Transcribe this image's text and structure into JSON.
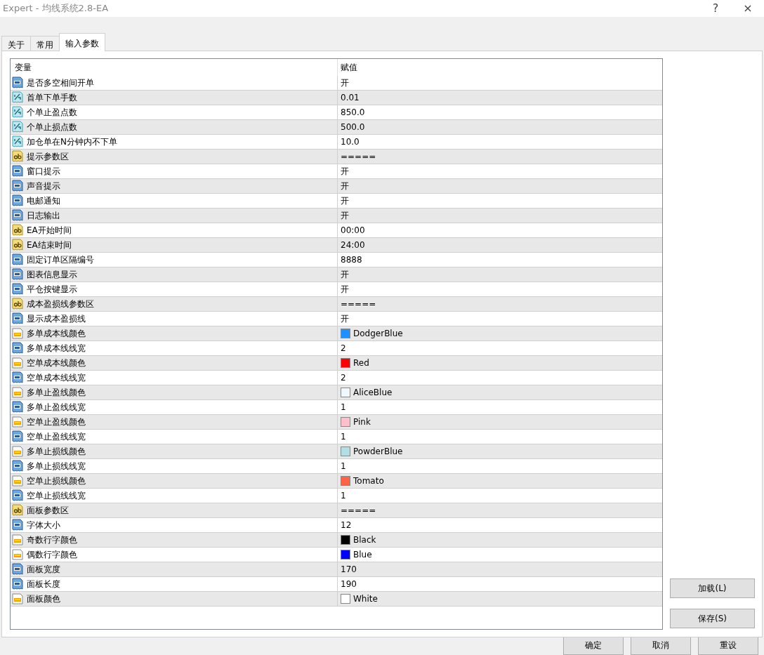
{
  "window": {
    "title": "Expert - 均线系统2.8-EA",
    "help": "?",
    "close": "×"
  },
  "tabs": [
    {
      "label": "关于",
      "selected": false
    },
    {
      "label": "常用",
      "selected": false
    },
    {
      "label": "输入参数",
      "selected": true
    }
  ],
  "table": {
    "columns": [
      "变量",
      "赋值"
    ],
    "rows": [
      {
        "kind": "int",
        "name": "是否多空相间开单",
        "value": "开"
      },
      {
        "kind": "double",
        "name": "首单下单手数",
        "value": "0.01"
      },
      {
        "kind": "double",
        "name": "个单止盈点数",
        "value": "850.0"
      },
      {
        "kind": "double",
        "name": "个单止损点数",
        "value": "500.0"
      },
      {
        "kind": "double",
        "name": "加仓单在N分钟内不下单",
        "value": "10.0"
      },
      {
        "kind": "string",
        "name": "提示参数区",
        "value": "====="
      },
      {
        "kind": "int",
        "name": "窗口提示",
        "value": "开"
      },
      {
        "kind": "int",
        "name": "声音提示",
        "value": "开"
      },
      {
        "kind": "int",
        "name": "电邮通知",
        "value": "开"
      },
      {
        "kind": "int",
        "name": "日志输出",
        "value": "开"
      },
      {
        "kind": "string",
        "name": "EA开始时间",
        "value": "00:00"
      },
      {
        "kind": "string",
        "name": "EA结束时间",
        "value": "24:00"
      },
      {
        "kind": "int",
        "name": "固定订单区隔编号",
        "value": "8888"
      },
      {
        "kind": "int",
        "name": "图表信息显示",
        "value": "开"
      },
      {
        "kind": "int",
        "name": "平仓按键显示",
        "value": "开"
      },
      {
        "kind": "string",
        "name": "成本盈损线参数区",
        "value": "====="
      },
      {
        "kind": "int",
        "name": "显示成本盈损线",
        "value": "开"
      },
      {
        "kind": "color",
        "name": "多单成本线颜色",
        "value": "DodgerBlue",
        "color": "#1e90ff"
      },
      {
        "kind": "int",
        "name": "多单成本线线宽",
        "value": "2"
      },
      {
        "kind": "color",
        "name": "空单成本线颜色",
        "value": "Red",
        "color": "#ff0000"
      },
      {
        "kind": "int",
        "name": "空单成本线线宽",
        "value": "2"
      },
      {
        "kind": "color",
        "name": "多单止盈线颜色",
        "value": "AliceBlue",
        "color": "#f0f8ff"
      },
      {
        "kind": "int",
        "name": "多单止盈线线宽",
        "value": "1"
      },
      {
        "kind": "color",
        "name": "空单止盈线颜色",
        "value": "Pink",
        "color": "#ffc0cb"
      },
      {
        "kind": "int",
        "name": "空单止盈线线宽",
        "value": "1"
      },
      {
        "kind": "color",
        "name": "多单止损线颜色",
        "value": "PowderBlue",
        "color": "#b0e0e6"
      },
      {
        "kind": "int",
        "name": "多单止损线线宽",
        "value": "1"
      },
      {
        "kind": "color",
        "name": "空单止损线颜色",
        "value": "Tomato",
        "color": "#ff6347"
      },
      {
        "kind": "int",
        "name": "空单止损线线宽",
        "value": "1"
      },
      {
        "kind": "string",
        "name": "面板参数区",
        "value": "====="
      },
      {
        "kind": "int",
        "name": "字体大小",
        "value": "12"
      },
      {
        "kind": "color",
        "name": "奇数行字颜色",
        "value": "Black",
        "color": "#000000"
      },
      {
        "kind": "color",
        "name": "偶数行字颜色",
        "value": "Blue",
        "color": "#0000ff"
      },
      {
        "kind": "int",
        "name": "面板宽度",
        "value": "170"
      },
      {
        "kind": "int",
        "name": "面板长度",
        "value": "190"
      },
      {
        "kind": "color",
        "name": "面板颜色",
        "value": "White",
        "color": "#ffffff"
      }
    ]
  },
  "side_buttons": [
    "加载(L)",
    "保存(S)"
  ],
  "buttons": [
    "确定",
    "取消",
    "重设"
  ]
}
